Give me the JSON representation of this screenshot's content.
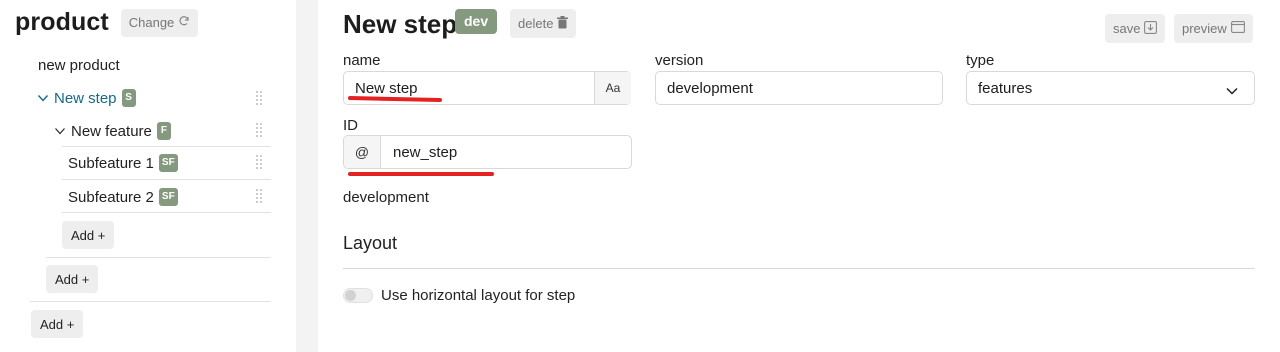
{
  "sidebar": {
    "title": "product",
    "change_label": "Change",
    "root_item": "new product",
    "step": {
      "label": "New step",
      "badge": "S"
    },
    "feature": {
      "label": "New feature",
      "badge": "F"
    },
    "subfeatures": [
      {
        "label": "Subfeature 1",
        "badge": "SF"
      },
      {
        "label": "Subfeature 2",
        "badge": "SF"
      }
    ],
    "add_subfeature_label": "Add +",
    "add_feature_label": "Add +",
    "add_step_label": "Add +"
  },
  "header": {
    "title": "New step",
    "env_badge": "dev",
    "delete_label": "delete",
    "save_label": "save",
    "preview_label": "preview"
  },
  "form": {
    "name_label": "name",
    "name_value": "New step",
    "name_addon": "Aa",
    "version_label": "version",
    "version_value": "development",
    "type_label": "type",
    "type_value": "features",
    "id_label": "ID",
    "id_prefix": "@",
    "id_value": "new_step",
    "version_text": "development"
  },
  "layout": {
    "section_title": "Layout",
    "horizontal_toggle_label": "Use horizontal layout for step",
    "horizontal_toggle_on": false
  },
  "colors": {
    "badge_green": "#84997e",
    "active_teal": "#146a87",
    "annotation_red": "#e52222"
  }
}
